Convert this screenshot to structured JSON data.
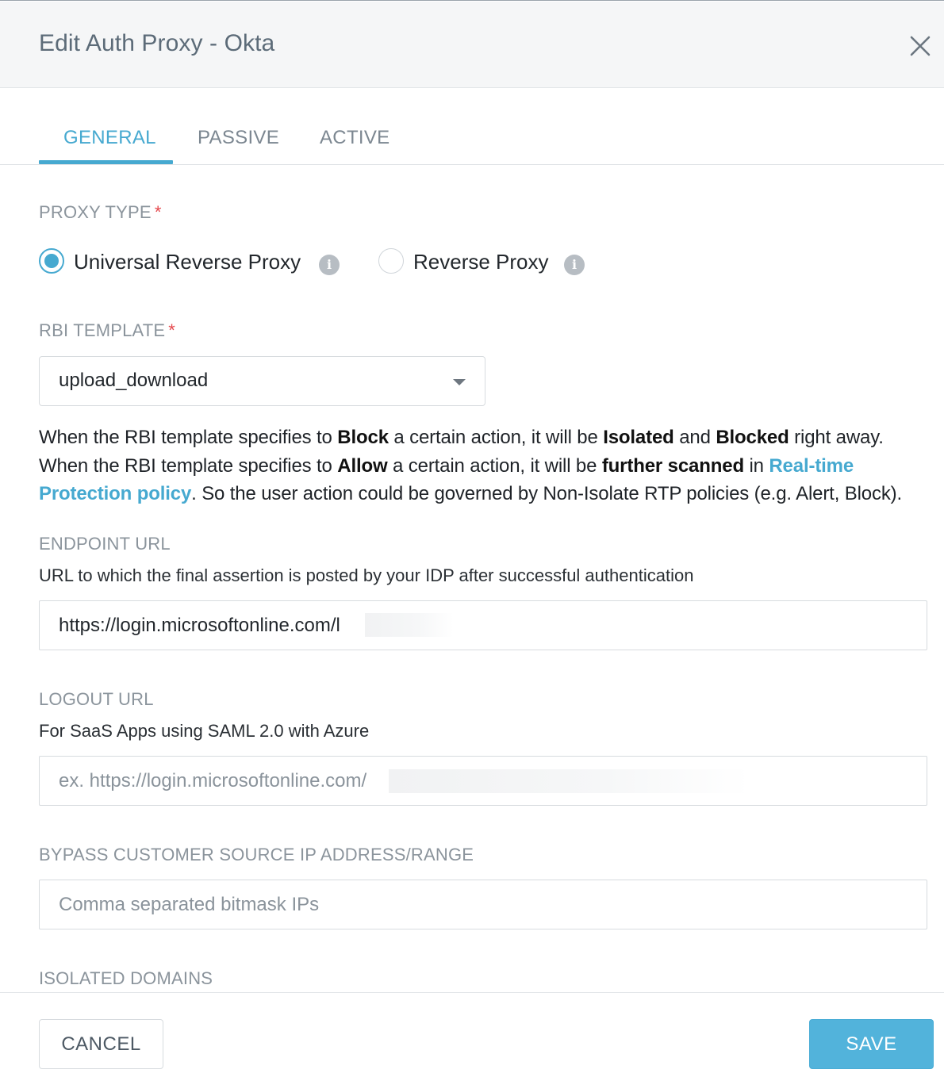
{
  "dialog": {
    "title": "Edit Auth Proxy - Okta",
    "close_icon": "close-icon"
  },
  "tabs": [
    {
      "label": "GENERAL",
      "active": true
    },
    {
      "label": "PASSIVE",
      "active": false
    },
    {
      "label": "ACTIVE",
      "active": false
    }
  ],
  "proxy_type": {
    "label": "PROXY TYPE",
    "required_mark": "*",
    "options": [
      {
        "label": "Universal Reverse Proxy",
        "selected": true,
        "icon": "info-icon"
      },
      {
        "label": "Reverse Proxy",
        "selected": false,
        "icon": "info-icon"
      }
    ]
  },
  "rbi_template": {
    "label": "RBI TEMPLATE",
    "required_mark": "*",
    "selected_value": "upload_download",
    "icon": "chevron-down-icon"
  },
  "description": {
    "line1_a": "When the RBI template specifies to ",
    "line1_b": "Block",
    "line1_c": " a certain action, it will be ",
    "line1_d": "Isolated",
    "line1_e": " and ",
    "line1_f": "Blocked",
    "line1_g": " right away.",
    "line2_a": "When the RBI template specifies to ",
    "line2_b": "Allow",
    "line2_c": " a certain action, it will be ",
    "line2_d": "further scanned",
    "line2_e": " in ",
    "link_text": "Real-time Protection policy",
    "line2_f": ". So the user action could be governed by Non-Isolate RTP policies (e.g. Alert, Block)."
  },
  "endpoint_url": {
    "label": "ENDPOINT URL",
    "hint": "URL to which the final assertion is posted by your IDP after successful authentication",
    "value": "https://login.microsoftonline.com/l"
  },
  "logout_url": {
    "label": "LOGOUT URL",
    "hint": "For SaaS Apps using SAML 2.0 with Azure",
    "placeholder": "ex. https://login.microsoftonline.com/"
  },
  "bypass": {
    "label": "BYPASS CUSTOMER SOURCE IP ADDRESS/RANGE",
    "placeholder": "Comma separated bitmask IPs"
  },
  "isolated_domains": {
    "label": "ISOLATED DOMAINS"
  },
  "footer": {
    "cancel_label": "CANCEL",
    "save_label": "SAVE"
  },
  "colors": {
    "accent": "#46a9d0",
    "required": "#e5484d",
    "label_gray": "#8b949c"
  }
}
